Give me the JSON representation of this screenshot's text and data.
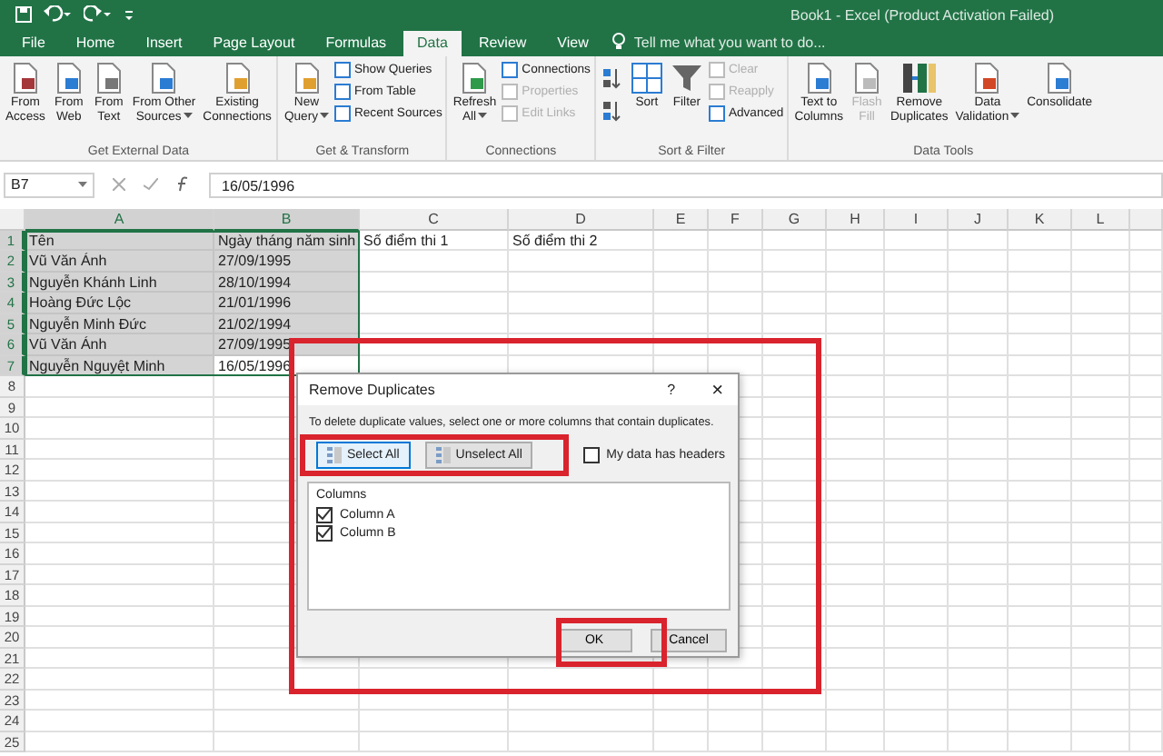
{
  "window": {
    "title": "Book1 - Excel (Product Activation Failed)"
  },
  "tabs": [
    {
      "label": "File",
      "selected": false
    },
    {
      "label": "Home",
      "selected": false
    },
    {
      "label": "Insert",
      "selected": false
    },
    {
      "label": "Page Layout",
      "selected": false
    },
    {
      "label": "Formulas",
      "selected": false
    },
    {
      "label": "Data",
      "selected": true
    },
    {
      "label": "Review",
      "selected": false
    },
    {
      "label": "View",
      "selected": false
    }
  ],
  "tell_me": {
    "placeholder": "Tell me what you want to do..."
  },
  "ribbon": [
    {
      "label": "Get External Data",
      "items": [
        {
          "kind": "large",
          "label": "From\nAccess",
          "dropdown": false,
          "disabled": false
        },
        {
          "kind": "large",
          "label": "From\nWeb",
          "dropdown": false,
          "disabled": false
        },
        {
          "kind": "large",
          "label": "From\nText",
          "dropdown": false,
          "disabled": false
        },
        {
          "kind": "large",
          "label": "From Other\nSources",
          "dropdown": true,
          "disabled": false
        },
        {
          "kind": "large",
          "label": "Existing\nConnections",
          "dropdown": false,
          "disabled": false
        }
      ]
    },
    {
      "label": "Get & Transform",
      "items": [
        {
          "kind": "large",
          "label": "New\nQuery",
          "dropdown": true,
          "disabled": false
        },
        {
          "kind": "stack",
          "items": [
            {
              "label": "Show Queries",
              "disabled": false
            },
            {
              "label": "From Table",
              "disabled": false
            },
            {
              "label": "Recent Sources",
              "disabled": false
            }
          ]
        }
      ]
    },
    {
      "label": "Connections",
      "items": [
        {
          "kind": "large",
          "label": "Refresh\nAll",
          "dropdown": true,
          "disabled": false
        },
        {
          "kind": "stack",
          "items": [
            {
              "label": "Connections",
              "disabled": false
            },
            {
              "label": "Properties",
              "disabled": true
            },
            {
              "label": "Edit Links",
              "disabled": true
            }
          ]
        }
      ]
    },
    {
      "label": "Sort & Filter",
      "items": [
        {
          "kind": "sort-icons"
        },
        {
          "kind": "large",
          "label": "Sort",
          "dropdown": false,
          "disabled": false
        },
        {
          "kind": "large",
          "label": "Filter",
          "dropdown": false,
          "disabled": false
        },
        {
          "kind": "stack",
          "items": [
            {
              "label": "Clear",
              "disabled": true
            },
            {
              "label": "Reapply",
              "disabled": true
            },
            {
              "label": "Advanced",
              "disabled": false
            }
          ]
        }
      ]
    },
    {
      "label": "Data Tools",
      "items": [
        {
          "kind": "large",
          "label": "Text to\nColumns",
          "dropdown": false,
          "disabled": false
        },
        {
          "kind": "large",
          "label": "Flash\nFill",
          "dropdown": false,
          "disabled": true
        },
        {
          "kind": "large",
          "label": "Remove\nDuplicates",
          "dropdown": false,
          "disabled": false
        },
        {
          "kind": "large",
          "label": "Data\nValidation",
          "dropdown": true,
          "disabled": false
        },
        {
          "kind": "large",
          "label": "Consolidate",
          "dropdown": false,
          "disabled": false
        }
      ]
    }
  ],
  "formula_bar": {
    "name_box": "B7",
    "value": "16/05/1996"
  },
  "sheet": {
    "columns": [
      {
        "label": "A",
        "selected": true
      },
      {
        "label": "B",
        "selected": true
      },
      {
        "label": "C",
        "selected": false
      },
      {
        "label": "D",
        "selected": false
      },
      {
        "label": "E",
        "selected": false
      },
      {
        "label": "F",
        "selected": false
      },
      {
        "label": "G",
        "selected": false
      },
      {
        "label": "H",
        "selected": false
      },
      {
        "label": "I",
        "selected": false
      },
      {
        "label": "J",
        "selected": false
      },
      {
        "label": "K",
        "selected": false
      },
      {
        "label": "L",
        "selected": false
      }
    ],
    "rows": [
      {
        "number": "1",
        "selected": true,
        "cells": [
          {
            "text": "Tên",
            "selected": true
          },
          {
            "text": "Ngày tháng năm sinh",
            "selected": true
          },
          {
            "text": "Số điểm thi 1",
            "selected": false
          },
          {
            "text": "Số điểm thi 2",
            "selected": false
          }
        ]
      },
      {
        "number": "2",
        "selected": true,
        "cells": [
          {
            "text": "Vũ Văn Ánh",
            "selected": true
          },
          {
            "text": "27/09/1995",
            "selected": true
          }
        ]
      },
      {
        "number": "3",
        "selected": true,
        "cells": [
          {
            "text": "Nguyễn Khánh Linh",
            "selected": true
          },
          {
            "text": "28/10/1994",
            "selected": true
          }
        ]
      },
      {
        "number": "4",
        "selected": true,
        "cells": [
          {
            "text": "Hoàng Đức Lộc",
            "selected": true
          },
          {
            "text": "21/01/1996",
            "selected": true
          }
        ]
      },
      {
        "number": "5",
        "selected": true,
        "cells": [
          {
            "text": "Nguyễn Minh Đức",
            "selected": true
          },
          {
            "text": "21/02/1994",
            "selected": true
          }
        ]
      },
      {
        "number": "6",
        "selected": true,
        "cells": [
          {
            "text": "Vũ Văn Ánh",
            "selected": true
          },
          {
            "text": "27/09/1995",
            "selected": true
          }
        ]
      },
      {
        "number": "7",
        "selected": true,
        "cells": [
          {
            "text": "Nguyễn Nguyệt Minh",
            "selected": true
          },
          {
            "text": "16/05/1996",
            "selected": false
          }
        ]
      },
      {
        "number": "8",
        "selected": false
      },
      {
        "number": "9",
        "selected": false
      },
      {
        "number": "10",
        "selected": false
      },
      {
        "number": "11",
        "selected": false
      },
      {
        "number": "12",
        "selected": false
      },
      {
        "number": "13",
        "selected": false
      },
      {
        "number": "14",
        "selected": false
      },
      {
        "number": "15",
        "selected": false
      },
      {
        "number": "16",
        "selected": false
      },
      {
        "number": "17",
        "selected": false
      },
      {
        "number": "18",
        "selected": false
      },
      {
        "number": "19",
        "selected": false
      },
      {
        "number": "20",
        "selected": false
      },
      {
        "number": "21",
        "selected": false
      },
      {
        "number": "22",
        "selected": false
      },
      {
        "number": "23",
        "selected": false
      },
      {
        "number": "24",
        "selected": false
      },
      {
        "number": "25",
        "selected": false
      }
    ]
  },
  "dialog": {
    "title": "Remove Duplicates",
    "help": "?",
    "close": "×",
    "instruction": "To delete duplicate values, select one or more columns that contain duplicates.",
    "buttons": [
      {
        "label": "Select All",
        "selected": true
      },
      {
        "label": "Unselect All",
        "selected": false
      }
    ],
    "headers_checkbox": {
      "label": "My data has headers",
      "checked": false
    },
    "list_title": "Columns",
    "columns": [
      {
        "label": "Column A",
        "checked": true
      },
      {
        "label": "Column B",
        "checked": true
      }
    ],
    "ok": "OK",
    "cancel": "Cancel"
  },
  "annotations": [
    {
      "kind": "dialog-frame",
      "color": "#d9232d"
    },
    {
      "kind": "select-buttons",
      "color": "#d9232d"
    },
    {
      "kind": "ok-button",
      "color": "#d9232d"
    }
  ]
}
